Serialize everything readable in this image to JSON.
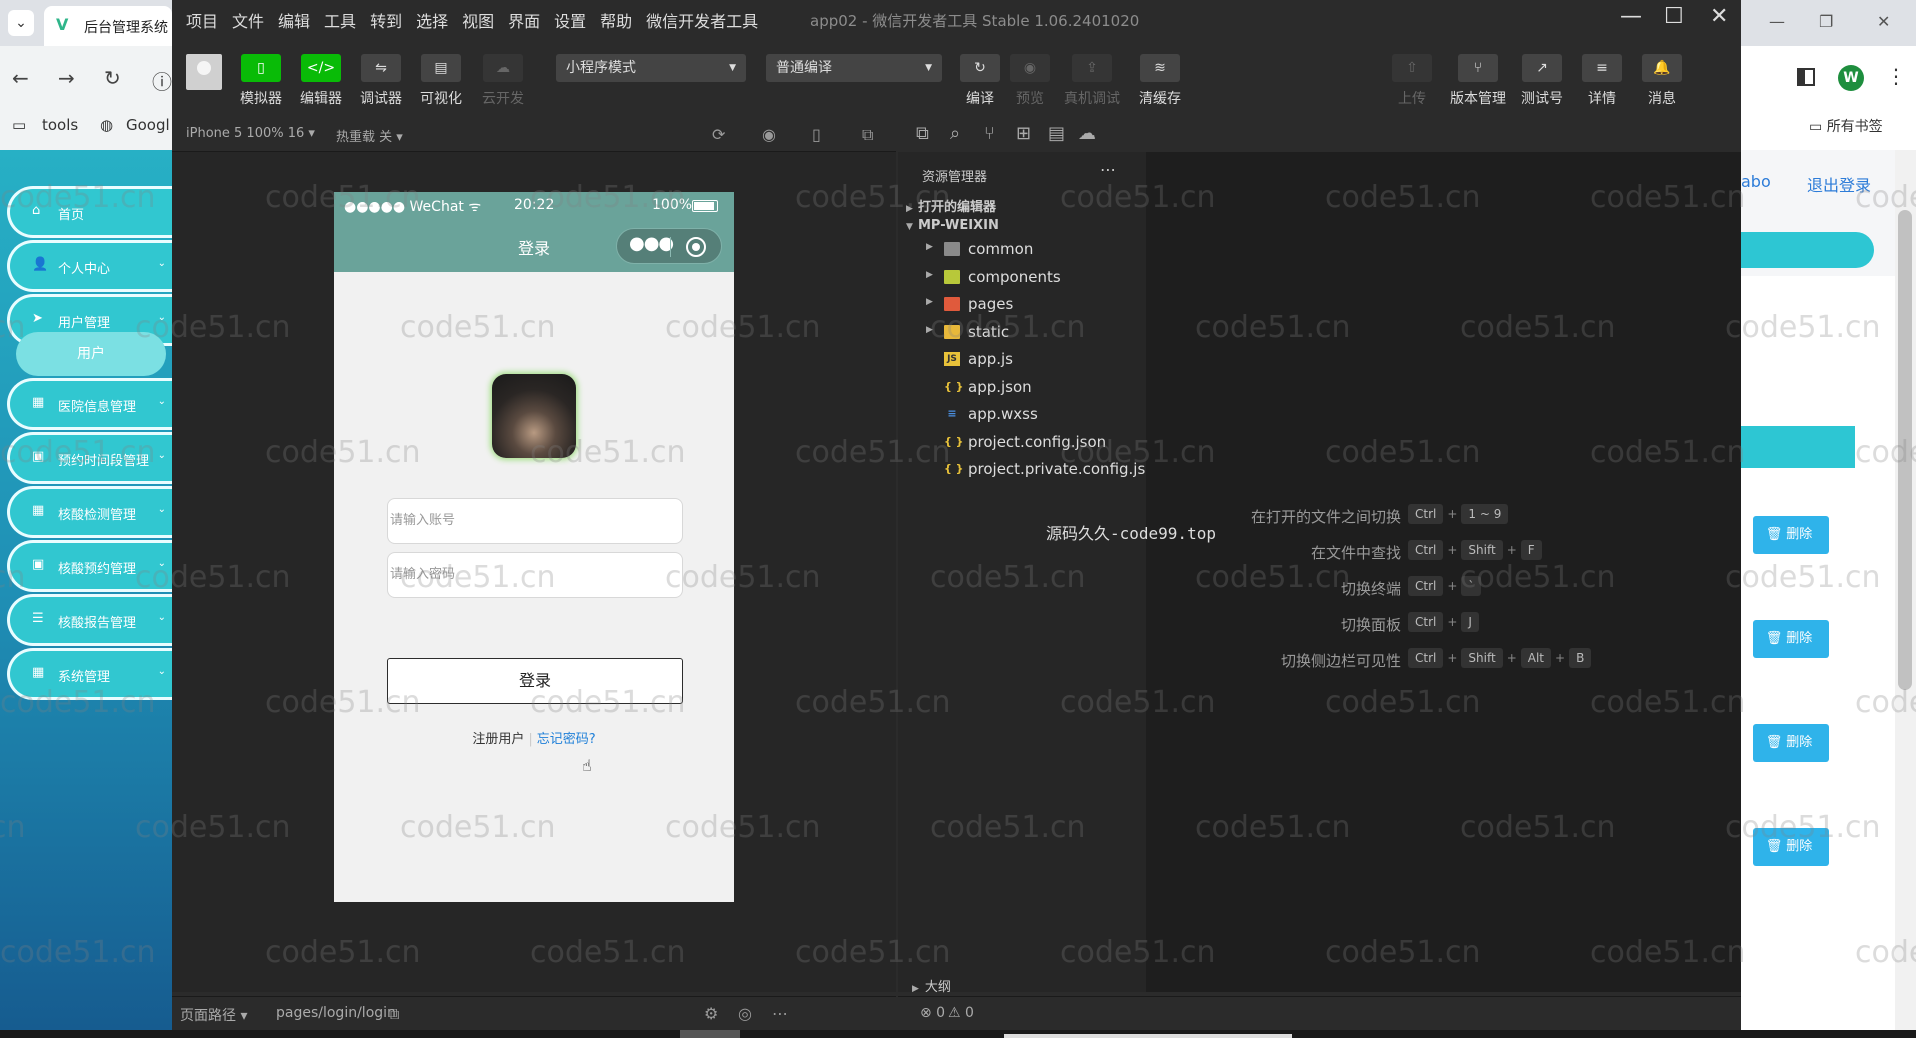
{
  "browser_left": {
    "tab_title": "后台管理系统",
    "bookmarks": [
      "tools",
      "Googl"
    ],
    "menu": [
      {
        "icon": "⌂",
        "label": "首页",
        "has_arrow": false
      },
      {
        "icon": "👤",
        "label": "个人中心",
        "has_arrow": true
      },
      {
        "icon": "➤",
        "label": "用户管理",
        "has_arrow": true
      },
      {
        "icon": "▦",
        "label": "医院信息管理",
        "has_arrow": true
      },
      {
        "icon": "▣",
        "label": "预约时间段管理",
        "has_arrow": true
      },
      {
        "icon": "▦",
        "label": "核酸检测管理",
        "has_arrow": true
      },
      {
        "icon": "▣",
        "label": "核酸预约管理",
        "has_arrow": true
      },
      {
        "icon": "☰",
        "label": "核酸报告管理",
        "has_arrow": true
      },
      {
        "icon": "▦",
        "label": "系统管理",
        "has_arrow": true
      }
    ],
    "submenu_active": "用户"
  },
  "browser_right": {
    "profile_initial": "W",
    "bookmarks_label": "所有书签",
    "user_text": "abo",
    "logout_label": "退出登录",
    "delete_label": "删除"
  },
  "devtools": {
    "menu": [
      "项目",
      "文件",
      "编辑",
      "工具",
      "转到",
      "选择",
      "视图",
      "界面",
      "设置",
      "帮助",
      "微信开发者工具"
    ],
    "title": "app02 - 微信开发者工具 Stable 1.06.2401020",
    "toolbar_left": [
      {
        "label": "模拟器",
        "icon": "▯"
      },
      {
        "label": "编辑器",
        "icon": "</>"
      },
      {
        "label": "调试器",
        "icon": "⇋"
      },
      {
        "label": "可视化",
        "icon": "▤"
      },
      {
        "label": "云开发",
        "icon": "☁"
      }
    ],
    "mode_select": "小程序模式",
    "compile_select": "普通编译",
    "toolbar_mid": [
      {
        "label": "编译",
        "icon": "↻"
      },
      {
        "label": "预览",
        "icon": "◉"
      },
      {
        "label": "真机调试",
        "icon": "⇪"
      },
      {
        "label": "清缓存",
        "icon": "≋"
      }
    ],
    "toolbar_right": [
      {
        "label": "上传",
        "icon": "⇧"
      },
      {
        "label": "版本管理",
        "icon": "⑂"
      },
      {
        "label": "测试号",
        "icon": "↗"
      },
      {
        "label": "详情",
        "icon": "≡"
      },
      {
        "label": "消息",
        "icon": "🔔"
      }
    ]
  },
  "simulator": {
    "device": "iPhone 5 100% 16 ▾",
    "hot_reload": "热重载 关 ▾",
    "status_carrier": "●●●●● WeChat ᯤ",
    "status_time": "20:22",
    "status_battery": "100%",
    "nav_title": "登录",
    "account_placeholder": "请输入账号",
    "password_placeholder": "请输入密码",
    "login_button": "登录",
    "register_link": "注册用户",
    "forgot_link": "忘记密码?",
    "page_path_label": "页面路径 ▾",
    "page_path": "pages/login/login"
  },
  "explorer": {
    "title": "资源管理器",
    "open_editors": "打开的编辑器",
    "project": "MP-WEIXIN",
    "items": [
      {
        "name": "common",
        "type": "folder",
        "color": "gray"
      },
      {
        "name": "components",
        "type": "folder",
        "color": "green"
      },
      {
        "name": "pages",
        "type": "folder",
        "color": "red"
      },
      {
        "name": "static",
        "type": "folder",
        "color": "yellow"
      },
      {
        "name": "app.js",
        "type": "js"
      },
      {
        "name": "app.json",
        "type": "json"
      },
      {
        "name": "app.wxss",
        "type": "wxss"
      },
      {
        "name": "project.config.json",
        "type": "json"
      },
      {
        "name": "project.private.config.js...",
        "type": "json"
      }
    ],
    "outline": "大纲"
  },
  "editor": {
    "overlay_text": "源码久久-code99.top",
    "shortcuts": [
      {
        "label": "在打开的文件之间切换",
        "keys": [
          "Ctrl",
          "1 ~ 9"
        ]
      },
      {
        "label": "在文件中查找",
        "keys": [
          "Ctrl",
          "Shift",
          "F"
        ]
      },
      {
        "label": "切换终端",
        "keys": [
          "Ctrl",
          "`"
        ]
      },
      {
        "label": "切换面板",
        "keys": [
          "Ctrl",
          "J"
        ]
      },
      {
        "label": "切换侧边栏可见性",
        "keys": [
          "Ctrl",
          "Shift",
          "Alt",
          "B"
        ]
      }
    ]
  },
  "status": {
    "errors": "⊗ 0",
    "warnings": "⚠ 0"
  },
  "watermark": "code51.cn"
}
